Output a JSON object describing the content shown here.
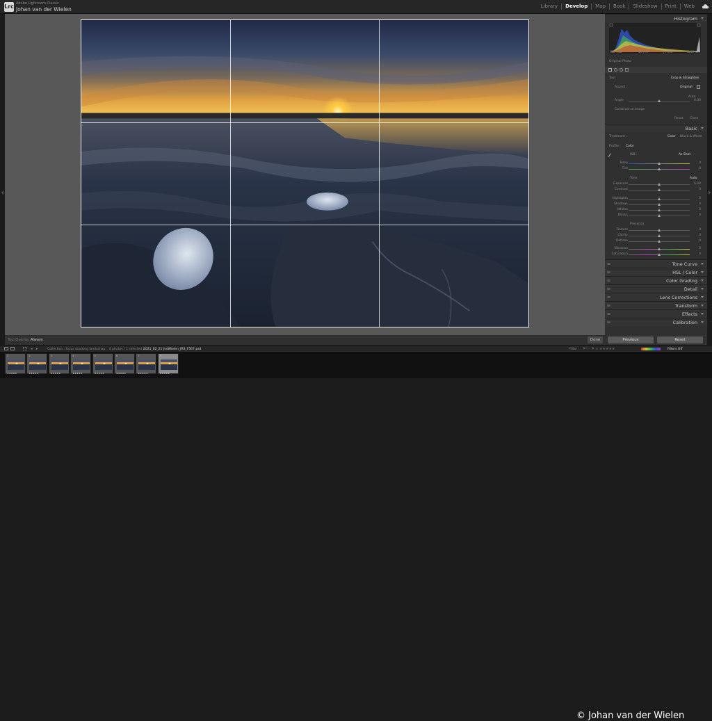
{
  "app": {
    "name": "Adobe Lightroom Classic",
    "user": "Johan van der Wielen",
    "logo": "Lrc"
  },
  "modules": [
    {
      "label": "Library",
      "active": false
    },
    {
      "label": "Develop",
      "active": true
    },
    {
      "label": "Map",
      "active": false
    },
    {
      "label": "Book",
      "active": false
    },
    {
      "label": "Slideshow",
      "active": false
    },
    {
      "label": "Print",
      "active": false
    },
    {
      "label": "Web",
      "active": false
    }
  ],
  "toolbar": {
    "overlay_label": "Tool Overlay :",
    "overlay_value": "Always",
    "done": "Done"
  },
  "histogram": {
    "title": "Histogram",
    "iso": "ISO 640",
    "focal": "16 mm",
    "aperture": "ƒ / 8.0",
    "shutter": "1/40 sec",
    "original": "Original Photo"
  },
  "crop": {
    "tool": "Tool",
    "tool_name": "Crop & Straighten",
    "aspect_label": "Aspect :",
    "aspect_value": "Original",
    "angle_label": "Angle",
    "angle_value": "0.00",
    "auto": "Auto",
    "constrain": "Constrain to Image",
    "reset": "Reset",
    "close": "Close"
  },
  "basic": {
    "title": "Basic",
    "treatment_label": "Treatment :",
    "color": "Color",
    "bw": "Black & White",
    "profile_label": "Profile :",
    "profile_value": "Color",
    "wb_label": "WB :",
    "wb_value": "As Shot",
    "temp": {
      "label": "Temp",
      "value": "0"
    },
    "tint": {
      "label": "Tint",
      "value": "0"
    },
    "tone_label": "Tone",
    "tone_auto": "Auto",
    "exposure": {
      "label": "Exposure",
      "value": "0.00"
    },
    "contrast": {
      "label": "Contrast",
      "value": "0"
    },
    "highlights": {
      "label": "Highlights",
      "value": "0"
    },
    "shadows": {
      "label": "Shadows",
      "value": "0"
    },
    "whites": {
      "label": "Whites",
      "value": "0"
    },
    "blacks": {
      "label": "Blacks",
      "value": "0"
    },
    "presence_label": "Presence",
    "texture": {
      "label": "Texture",
      "value": "0"
    },
    "clarity": {
      "label": "Clarity",
      "value": "0"
    },
    "dehaze": {
      "label": "Dehaze",
      "value": "0"
    },
    "vibrance": {
      "label": "Vibrance",
      "value": "0"
    },
    "saturation": {
      "label": "Saturation",
      "value": "0"
    }
  },
  "panels": {
    "tone_curve": "Tone Curve",
    "hsl": "HSL / Color",
    "color_grading": "Color Grading",
    "detail": "Detail",
    "lens": "Lens Corrections",
    "transform": "Transform",
    "effects": "Effects",
    "calibration": "Calibration"
  },
  "bottom_buttons": {
    "previous": "Previous",
    "reset": "Reset"
  },
  "filmbar": {
    "source": "Collection : focus stacking landschap",
    "count": "8 photos / 1 selected /",
    "filename": "2021_02_21 JvdWielen_JRS_F507.psd",
    "filter_label": "Filter :",
    "filters_off": "Filters Off"
  },
  "filmstrip": {
    "thumbs": [
      {
        "num": "1",
        "stars": "★★★★★"
      },
      {
        "num": "2",
        "stars": "★★★★★"
      },
      {
        "num": "3",
        "stars": "★★★★★"
      },
      {
        "num": "4",
        "stars": "★★★★★"
      },
      {
        "num": "5",
        "stars": "★★★★★"
      },
      {
        "num": "6",
        "stars": "★★★★★"
      },
      {
        "num": "7",
        "stars": "★★★★★"
      },
      {
        "num": "8",
        "stars": "★★★★★"
      }
    ],
    "selected_index": 7
  },
  "watermark": "© Johan van der Wielen",
  "colors": {
    "accent": "#ffffff",
    "panel_bg": "#303030",
    "canvas_bg": "#585858"
  }
}
